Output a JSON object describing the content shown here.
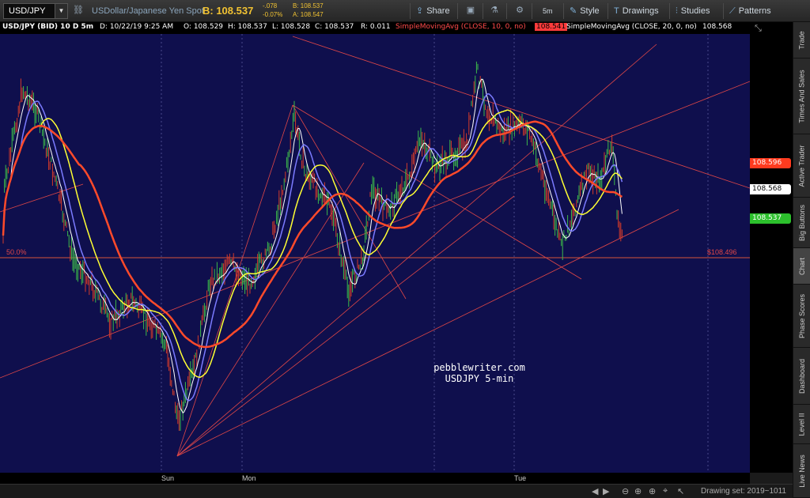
{
  "toolbar": {
    "symbol": "USD/JPY",
    "description": "USDollar/Japanese Yen Spot",
    "bid": "B: 108.537",
    "change": "-.078",
    "change_pct": "-0.07%",
    "bid_small": "B: 108.537",
    "ask_small": "A: 108.547",
    "buttons": {
      "share": "Share",
      "timeframe": "5m",
      "style": "Style",
      "drawings": "Drawings",
      "studies": "Studies",
      "patterns": "Patterns"
    }
  },
  "header": {
    "symbol_label": "USD/JPY (BID) 10 D 5m",
    "date": "D: 10/22/19 9:25 AM",
    "open": "O: 108.529",
    "high": "H: 108.537",
    "low": "L: 108.528",
    "close": "C: 108.537",
    "range": "R: 0.011",
    "sma10_label": "SimpleMovingAvg (CLOSE, 10, 0, no)",
    "sma10_value": "108.541",
    "sma20_label": "SimpleMovingAvg (CLOSE, 20, 0, no)",
    "sma20_value": "108.568"
  },
  "price_labels": {
    "red": "108.596",
    "white": "108.568",
    "green": "108.537",
    "fib_right": "$108.496"
  },
  "fib_level_label": "50.0%",
  "x_axis": {
    "sun": "Sun",
    "mon": "Mon",
    "tue": "Tue"
  },
  "watermark": {
    "line1": "pebblewriter.com",
    "line2": "USDJPY 5-min"
  },
  "drawing_set": "Drawing set: 2019~1011",
  "side_tabs": [
    "Trade",
    "Times And Sales",
    "Active Trader",
    "Big Buttons",
    "Chart",
    "Phase Scores",
    "Dashboard",
    "Level II",
    "Live News"
  ],
  "colors": {
    "background": "#0f0f4d",
    "up_bar": "#3cb84a",
    "down_bar": "#d23a2a",
    "sma_red": "#ff4a2a",
    "sma_yellow": "#ffff33",
    "sma_blue": "#7b7bff",
    "sma_white": "#ffffff",
    "trendline": "#e04747"
  }
}
